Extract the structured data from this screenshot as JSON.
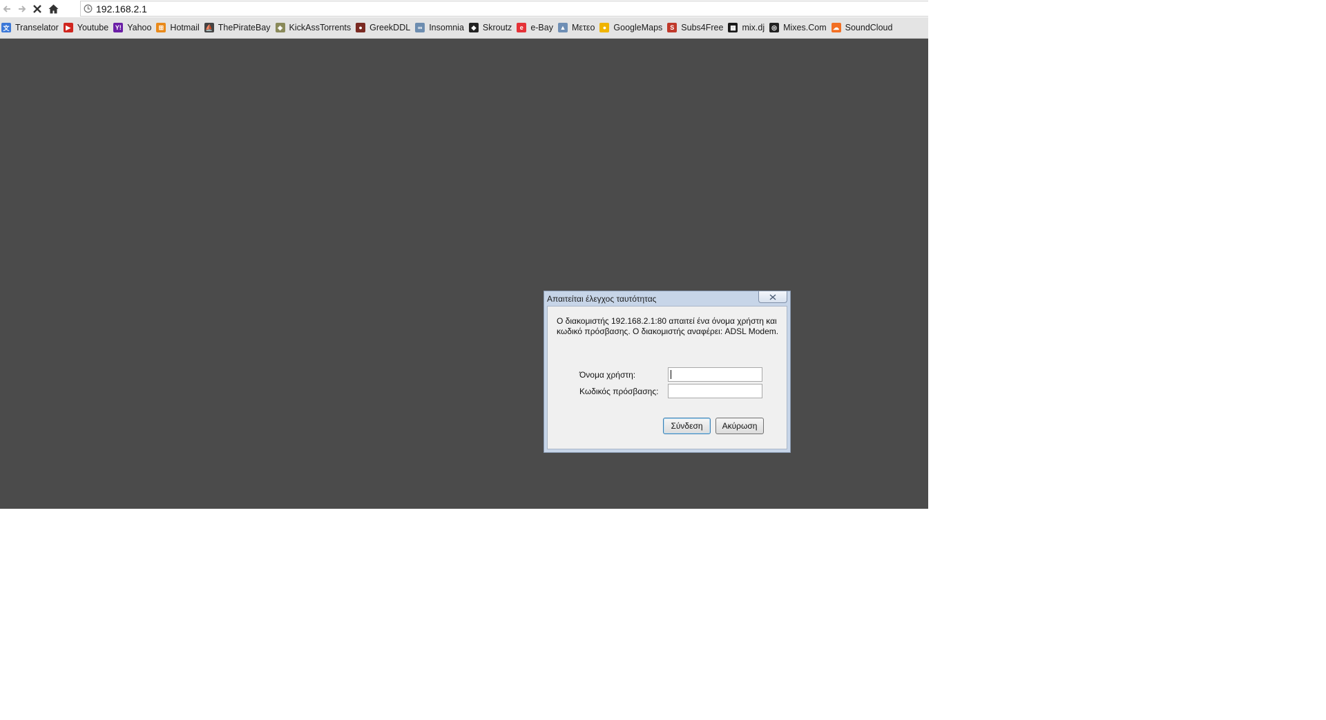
{
  "browser": {
    "url": "192.168.2.1",
    "bookmarks": [
      {
        "label": "Transelator",
        "icon": "translate-icon",
        "color": "#3b78d8"
      },
      {
        "label": "Youtube",
        "icon": "youtube-icon",
        "color": "#d0261f"
      },
      {
        "label": "Yahoo",
        "icon": "yahoo-icon",
        "color": "#6b1fa6"
      },
      {
        "label": "Hotmail",
        "icon": "windows-flag-icon",
        "color": "#e98a1b"
      },
      {
        "label": "ThePirateBay",
        "icon": "pirate-ship-icon",
        "color": "#444444"
      },
      {
        "label": "KickAssTorrents",
        "icon": "shield-icon",
        "color": "#8a8a5a"
      },
      {
        "label": "GreekDDL",
        "icon": "greekddl-icon",
        "color": "#7a2a22"
      },
      {
        "label": "Insomnia",
        "icon": "eyes-icon",
        "color": "#6d8db0"
      },
      {
        "label": "Skroutz",
        "icon": "skroutz-icon",
        "color": "#222222"
      },
      {
        "label": "e-Bay",
        "icon": "ebay-icon",
        "color": "#e53238"
      },
      {
        "label": "Μετεο",
        "icon": "mountain-icon",
        "color": "#6f8fb5"
      },
      {
        "label": "GoogleMaps",
        "icon": "map-pin-icon",
        "color": "#f0b400"
      },
      {
        "label": "Subs4Free",
        "icon": "s4f-icon",
        "color": "#c0392b"
      },
      {
        "label": "mix.dj",
        "icon": "mixdj-icon",
        "color": "#1a1a1a"
      },
      {
        "label": "Mixes.Com",
        "icon": "mixes-icon",
        "color": "#222222"
      },
      {
        "label": "SoundCloud",
        "icon": "soundcloud-icon",
        "color": "#f26f23"
      }
    ]
  },
  "dialog": {
    "title": "Απαιτείται έλεγχος ταυτότητας",
    "message": "Ο διακομιστής 192.168.2.1:80 απαιτεί ένα όνομα χρήστη και κωδικό πρόσβασης. Ο διακομιστής αναφέρει: ADSL Modem.",
    "username_label": "Όνομα χρήστη:",
    "password_label": "Κωδικός πρόσβασης:",
    "username_value": "",
    "password_value": "",
    "login_button": "Σύνδεση",
    "cancel_button": "Ακύρωση"
  },
  "colors": {
    "content_background": "#4b4b4b",
    "dialog_frame": "#c7d5e8"
  }
}
